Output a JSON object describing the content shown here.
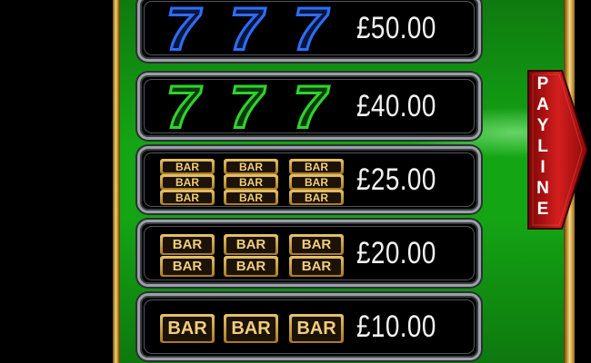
{
  "paytable": {
    "rows": [
      {
        "symbol": "blue-seven-icon",
        "prize": "£50.00",
        "color": "#2f6cf6"
      },
      {
        "symbol": "green-seven-icon",
        "prize": "£40.00",
        "color": "#31d12e"
      },
      {
        "symbol": "triple-bar-icon",
        "prize": "£25.00",
        "color": "#d9b75c"
      },
      {
        "symbol": "double-bar-icon",
        "prize": "£20.00",
        "color": "#d9b75c"
      },
      {
        "symbol": "single-bar-icon",
        "prize": "£10.00",
        "color": "#d9b75c"
      }
    ],
    "bar_text": "BAR",
    "seven_text": "7"
  },
  "payline": {
    "label": "PAYLINE",
    "color": "#c01818"
  },
  "colors": {
    "table_felt": "#14a514",
    "gold_frame": "#d8ad4a"
  }
}
